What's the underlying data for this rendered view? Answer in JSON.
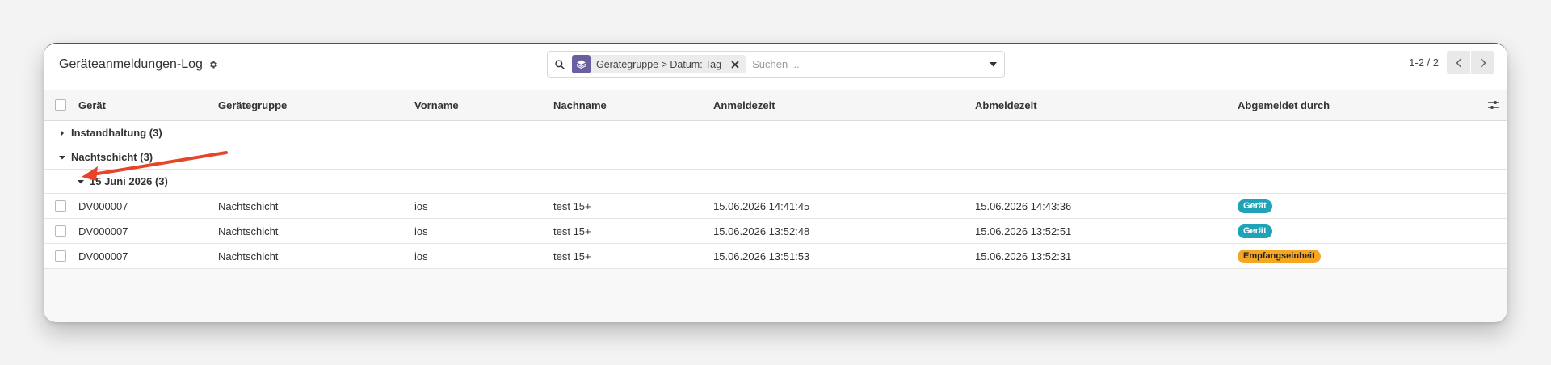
{
  "controlbar": {
    "title": "Geräteanmeldungen-Log",
    "search": {
      "facet": "Gerätegruppe > Datum: Tag",
      "placeholder": "Suchen ..."
    },
    "pager": {
      "text": "1-2 / 2"
    }
  },
  "table": {
    "columns": [
      "Gerät",
      "Gerätegruppe",
      "Vorname",
      "Nachname",
      "Anmeldezeit",
      "Abmeldezeit",
      "Abgemeldet durch"
    ],
    "groups": [
      {
        "label": "Instandhaltung (3)",
        "expanded": false
      },
      {
        "label": "Nachtschicht (3)",
        "expanded": true
      }
    ],
    "subgroup": {
      "label": "15 Juni 2026 (3)",
      "expanded": true
    },
    "rows": [
      {
        "device": "DV000007",
        "group": "Nachtschicht",
        "firstname": "ios",
        "lastname": "test 15+",
        "login": "15.06.2026 14:41:45",
        "logout": "15.06.2026 14:43:36",
        "by": "Gerät"
      },
      {
        "device": "DV000007",
        "group": "Nachtschicht",
        "firstname": "ios",
        "lastname": "test 15+",
        "login": "15.06.2026 13:52:48",
        "logout": "15.06.2026 13:52:51",
        "by": "Gerät"
      },
      {
        "device": "DV000007",
        "group": "Nachtschicht",
        "firstname": "ios",
        "lastname": "test 15+",
        "login": "15.06.2026 13:51:53",
        "logout": "15.06.2026 13:52:31",
        "by": "Empfangseinheit"
      }
    ]
  },
  "colors": {
    "accent": "#6b5f9f",
    "badge_device": "#1fa3b8",
    "badge_reception": "#f5a623",
    "annotation_arrow": "#e8442b"
  },
  "icons": [
    "gear-icon",
    "search-icon",
    "layers-icon",
    "close-icon",
    "caret-down-icon",
    "chevron-left-icon",
    "chevron-right-icon",
    "column-settings-icon",
    "caret-right-icon"
  ]
}
